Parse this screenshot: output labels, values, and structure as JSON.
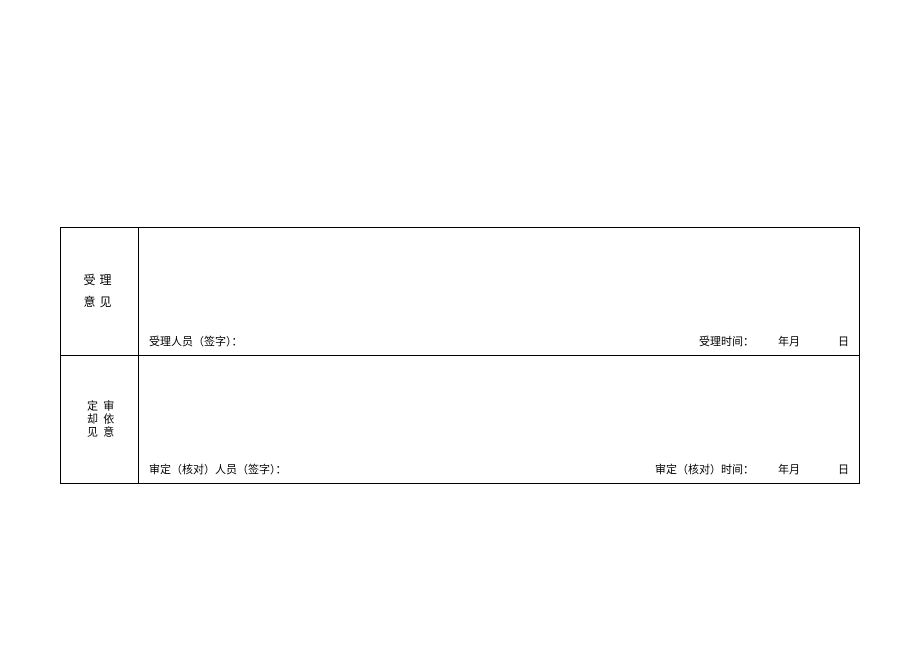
{
  "rows": [
    {
      "label_line1": "受理",
      "label_line2": "意见",
      "signer_label": "受理人员（签字）：",
      "time_label": "受理时间：",
      "date_ym": "年月",
      "date_d": "日"
    },
    {
      "label_vertical_col1": "定却见",
      "label_vertical_col2": "审依意",
      "signer_label": "审定（核对）人员（签字）：",
      "time_label": "审定（核对）时间：",
      "date_ym": "年月",
      "date_d": "日"
    }
  ]
}
